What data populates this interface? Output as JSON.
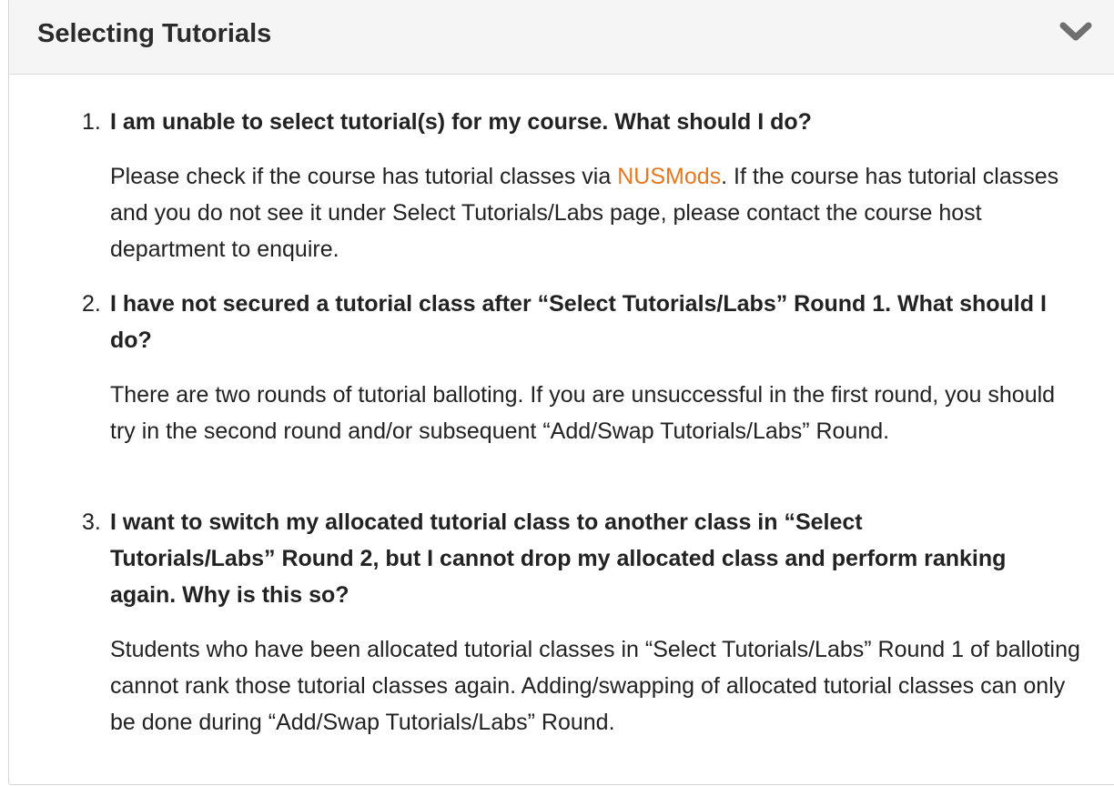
{
  "panel": {
    "title": "Selecting Tutorials",
    "toggle_icon": "chevron-down-icon",
    "colors": {
      "header_bg": "#f5f5f5",
      "link": "#e8781e",
      "text": "#222222"
    }
  },
  "faqs": [
    {
      "number": "1.",
      "question": "I am unable to select tutorial(s) for my course. What should I do?",
      "answer_before_link": "Please check if the course has tutorial classes via ",
      "link_text": "NUSMods",
      "answer_after_link": ". If the course has tutorial classes and you do not see it under Select Tutorials/Labs page, please contact the course host department to enquire."
    },
    {
      "number": "2.",
      "question": "I have not secured a tutorial class after “Select Tutorials/Labs” Round 1. What should I do?",
      "answer": "There are two rounds of tutorial balloting. If you are unsuccessful in the first round, you should try in the second round and/or subsequent “Add/Swap Tutorials/Labs” Round."
    },
    {
      "number": "3.",
      "question": "I want to switch my allocated tutorial class to another class in “Select Tutorials/Labs” Round 2, but I cannot drop my allocated class and perform ranking again. Why is this so?",
      "answer": "Students who have been allocated tutorial classes in “Select Tutorials/Labs” Round 1 of balloting cannot rank those tutorial classes again. Adding/swapping of allocated tutorial classes can only be done during “Add/Swap Tutorials/Labs” Round."
    }
  ]
}
